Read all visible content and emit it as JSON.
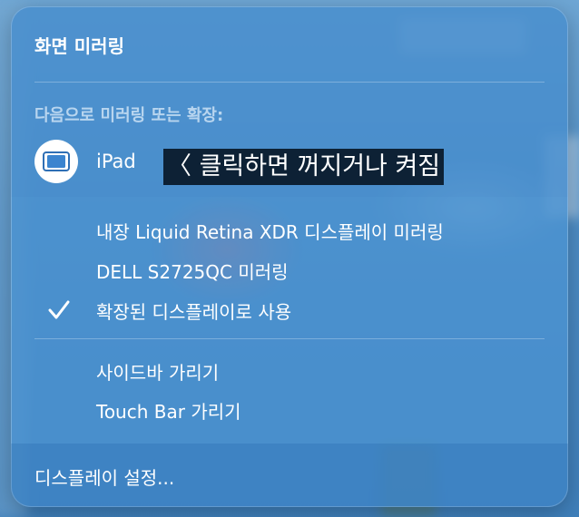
{
  "menu": {
    "title": "화면 미러링",
    "section_label": "다음으로 미러링 또는 확장:",
    "device": {
      "label": "iPad",
      "icon": "ipad-display-icon"
    },
    "annotation": "〈 클릭하면 꺼지거나 켜짐",
    "display_options": [
      {
        "label": "내장 Liquid Retina XDR 디스플레이 미러링",
        "checked": false
      },
      {
        "label": "DELL S2725QC 미러링",
        "checked": false
      },
      {
        "label": "확장된 디스플레이로 사용",
        "checked": true
      }
    ],
    "extra_options": [
      {
        "label": "사이드바 가리기"
      },
      {
        "label": "Touch Bar 가리기"
      }
    ],
    "footer": "디스플레이 설정..."
  },
  "colors": {
    "panel": "#4289CB",
    "text": "#FFFFFF",
    "section_label": "#DCECFA",
    "annotation_bg": "#0D2135"
  },
  "icons": [
    "ipad-display-icon",
    "checkmark-icon"
  ]
}
